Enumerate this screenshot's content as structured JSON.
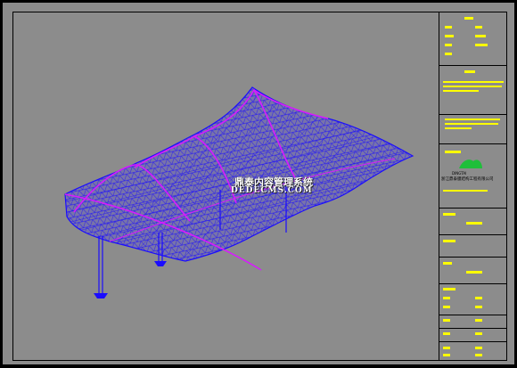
{
  "watermark": {
    "line1": "鼎泰内容管理系统",
    "line2": "DEDECMS.COM"
  },
  "title_block": {
    "company_name": "浙江鼎泰膜结构工程有限公司",
    "company_logo_text": "DINGTAI",
    "colors": {
      "text": "#ffff00",
      "frame": "#000000",
      "background": "#8c8c8c",
      "structure_blue": "#1a0cff",
      "structure_magenta": "#d81aff"
    }
  },
  "drawing": {
    "subject": "tensile membrane canopy 3D frame"
  }
}
